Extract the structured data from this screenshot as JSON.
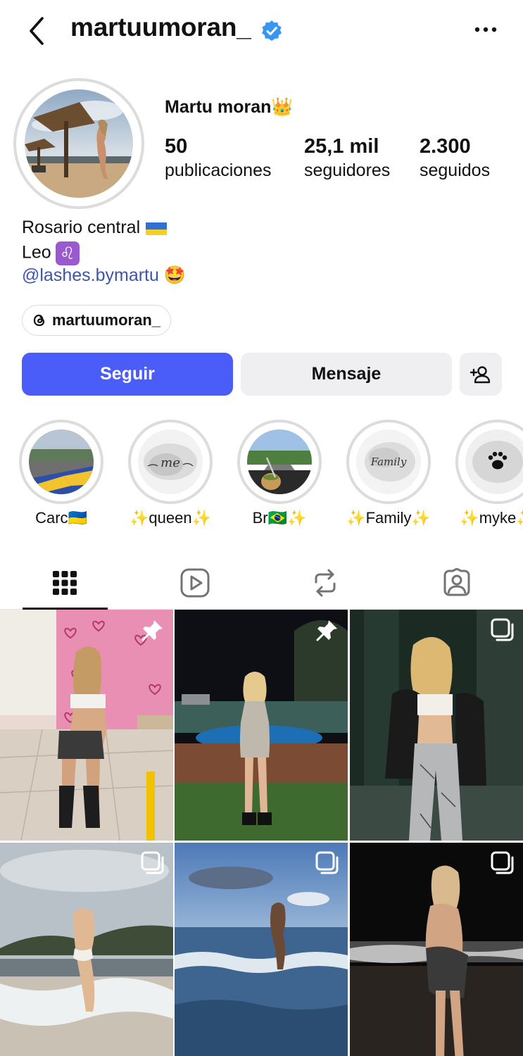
{
  "header": {
    "username": "martuumoran_",
    "back_icon": "chevron-left-icon",
    "verified_icon": "verified-badge-icon",
    "more_icon": "more-horizontal-icon"
  },
  "profile": {
    "display_name": "Martu moran👑",
    "stats": [
      {
        "value": "50",
        "label": "publicaciones"
      },
      {
        "value": "25,1 mil",
        "label": "seguidores"
      },
      {
        "value": "2.300",
        "label": "seguidos"
      }
    ],
    "bio": {
      "line1": "Rosario central",
      "line2": "Leo",
      "link": "@lashes.bymartu",
      "link_emoji": "🤩"
    },
    "threads_handle": "martuumoran_"
  },
  "actions": {
    "follow_label": "Seguir",
    "message_label": "Mensaje",
    "add_user_icon": "add-user-icon"
  },
  "highlights": [
    {
      "label": "Carc🇺🇦"
    },
    {
      "label": "✨queen✨"
    },
    {
      "label": "Br🇧🇷✨"
    },
    {
      "label": "✨Family✨"
    },
    {
      "label": "✨myke✨"
    }
  ],
  "highlight_inner_text": {
    "queen": "me",
    "family": "Family"
  },
  "tabs": [
    {
      "name": "posts",
      "icon": "grid-icon",
      "active": true
    },
    {
      "name": "reels",
      "icon": "reels-icon",
      "active": false
    },
    {
      "name": "reposts",
      "icon": "repost-icon",
      "active": false
    },
    {
      "name": "tagged",
      "icon": "tagged-icon",
      "active": false
    }
  ],
  "posts": [
    {
      "badge": "pin-icon"
    },
    {
      "badge": "pin-icon"
    },
    {
      "badge": "carousel-icon"
    },
    {
      "badge": "carousel-icon"
    },
    {
      "badge": "carousel-icon"
    },
    {
      "badge": "carousel-icon"
    }
  ],
  "colors": {
    "accent": "#4a5df9",
    "link": "#3d56a6",
    "verified": "#3797f0",
    "button_secondary": "#efeff1"
  }
}
